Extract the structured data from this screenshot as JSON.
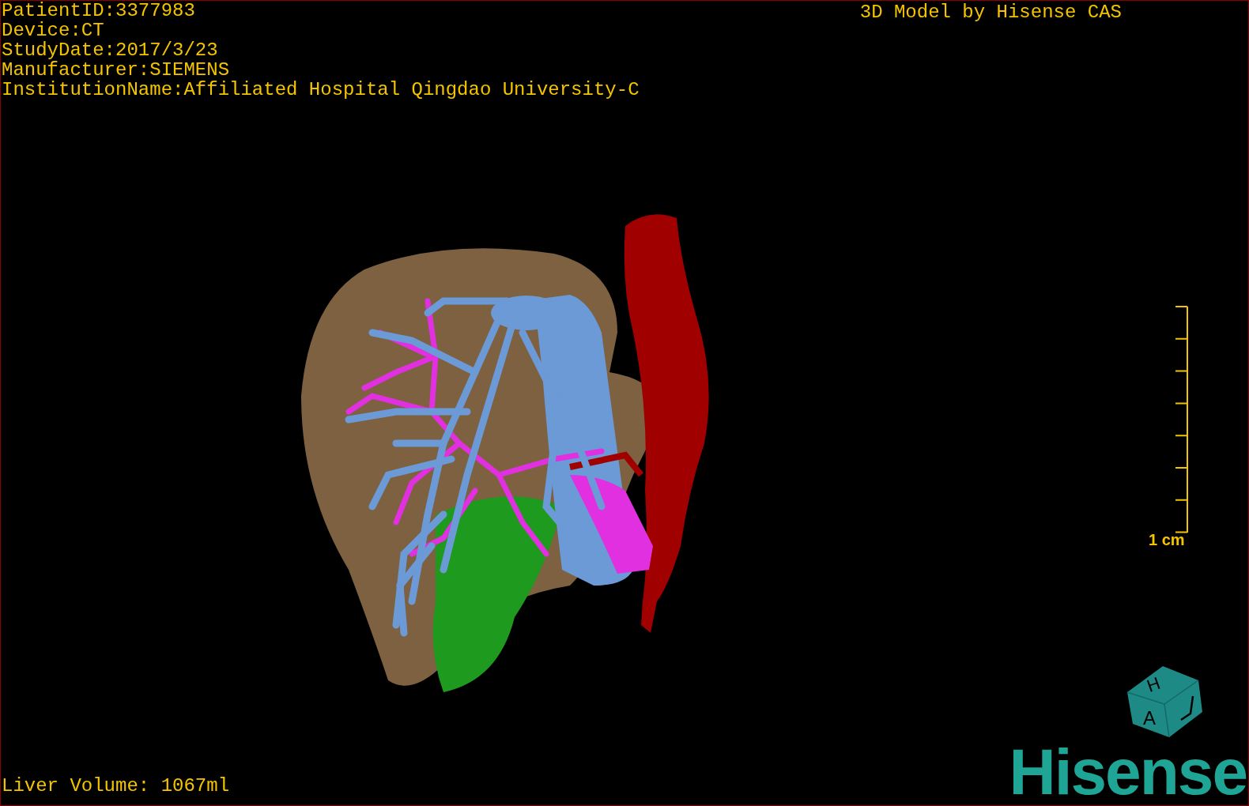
{
  "overlay": {
    "patient_info": [
      "PatientID:3377983",
      "Device:CT",
      "StudyDate:2017/3/23",
      "Manufacturer:SIEMENS",
      "InstitutionName:Affiliated Hospital Qingdao University-C"
    ],
    "model_credit": "3D Model by Hisense CAS",
    "liver_volume": "Liver Volume: 1067ml"
  },
  "scale_bar": {
    "label": "1 cm"
  },
  "orientation_cube": {
    "faces": [
      "H",
      "A"
    ]
  },
  "logo": "Hisense"
}
